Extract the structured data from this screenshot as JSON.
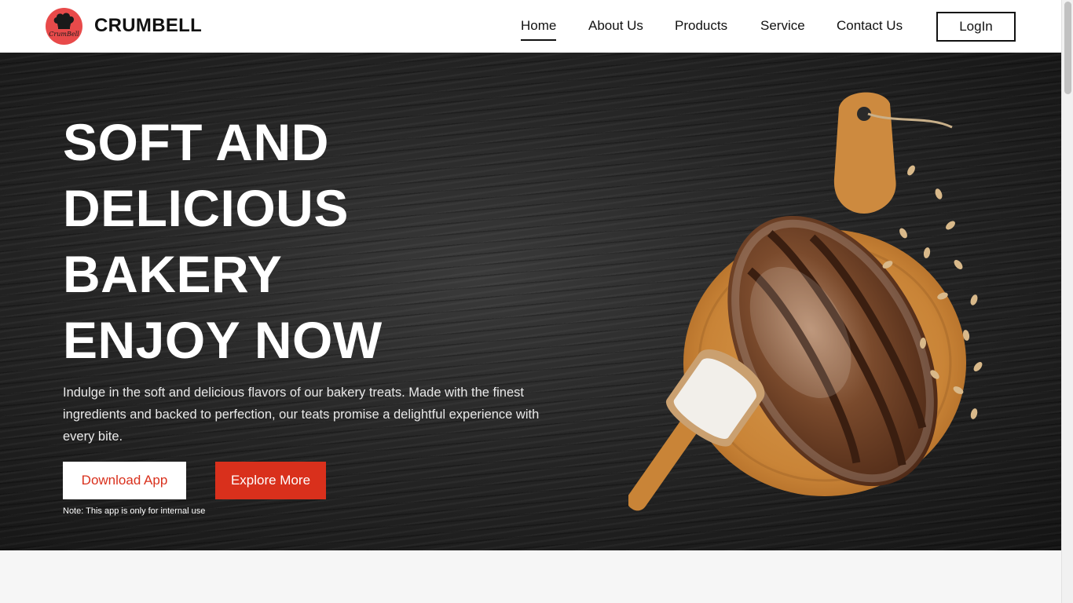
{
  "brand": {
    "name": "CRUMBELL",
    "logo_text": "CrumBell"
  },
  "nav": {
    "items": [
      {
        "label": "Home",
        "active": true
      },
      {
        "label": "About Us",
        "active": false
      },
      {
        "label": "Products",
        "active": false
      },
      {
        "label": "Service",
        "active": false
      },
      {
        "label": "Contact Us",
        "active": false
      }
    ],
    "login_label": "LogIn"
  },
  "hero": {
    "title_lines": [
      "SOFT AND",
      "DELICIOUS",
      "BAKERY",
      "ENJOY NOW"
    ],
    "description": "Indulge in the soft and delicious flavors of our bakery treats. Made with the finest ingredients and backed to perfection, our teats promise a delightful experience with every bite.",
    "download_label": "Download App",
    "explore_label": "Explore More",
    "note": "Note: This app is only for internal use"
  },
  "colors": {
    "accent": "#d9301c",
    "logo_bg": "#e84a4a",
    "hero_bg": "#262626"
  },
  "icons": {
    "logo": "chef-hat-icon",
    "hero": "bread-on-board-image"
  }
}
